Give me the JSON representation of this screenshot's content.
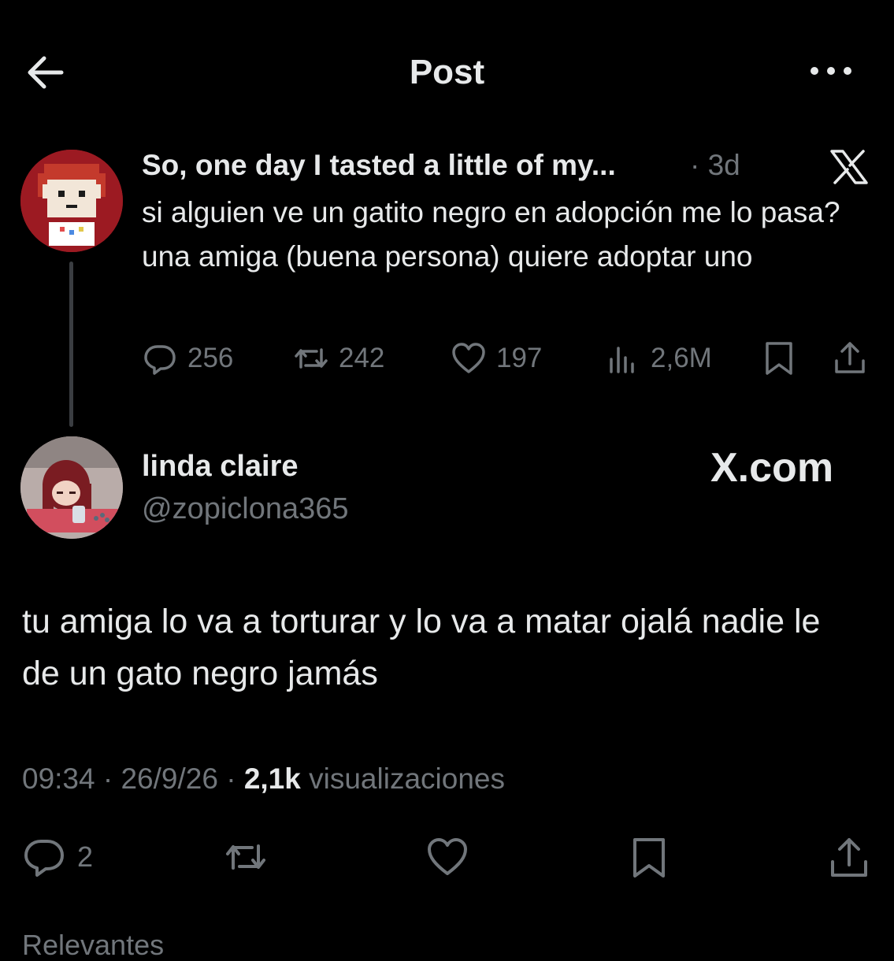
{
  "header": {
    "title": "Post",
    "back_icon": "arrow-left-icon",
    "more_icon": "more-horizontal-icon"
  },
  "parent_tweet": {
    "display_name": "So, one day I tasted a little of my...",
    "time": "· 3d",
    "text": "si alguien ve un gatito negro en adopción me lo pasa? una amiga (buena persona) quiere adoptar uno",
    "actions": {
      "replies": "256",
      "reposts": "242",
      "likes": "197",
      "views": "2,6M"
    }
  },
  "main_tweet": {
    "display_name": "linda claire",
    "handle": "@zopiclona365",
    "watermark": "X.com",
    "text": "tu amiga lo va a torturar y lo va a matar ojalá nadie le de un gato negro jamás",
    "meta": {
      "time": "09:34",
      "date": "26/9/26",
      "views_count": "2,1k",
      "views_label": "visualizaciones"
    },
    "actions": {
      "replies": "2"
    }
  },
  "footer": {
    "relevant_label": "Relevantes"
  },
  "colors": {
    "background": "#000000",
    "primary_text": "#e7e9ea",
    "secondary_text": "#71767b"
  }
}
